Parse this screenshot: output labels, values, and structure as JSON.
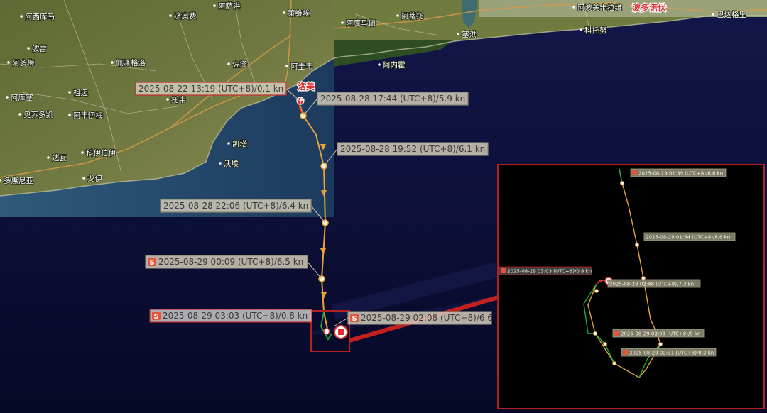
{
  "places": [
    {
      "id": "a-xi-ku-ma",
      "name": "阿西库马"
    },
    {
      "id": "ji-ao-fei",
      "name": "济奥费"
    },
    {
      "id": "a-sa-hong",
      "name": "阿萨洪"
    },
    {
      "id": "ce-wei-kui",
      "name": "策维埃"
    },
    {
      "id": "a-ku-ma-pei",
      "name": "阿库马佩"
    },
    {
      "id": "a-di-tuo",
      "name": "阿蒂托"
    },
    {
      "id": "a-bo-mei",
      "name": "阿波美卡拉维"
    },
    {
      "id": "bo-duo",
      "name": "波多诺伏"
    },
    {
      "id": "ba-da",
      "name": "巴达格里"
    },
    {
      "id": "sai-hong",
      "name": "塞洪"
    },
    {
      "id": "ke-li-wu",
      "name": "科托努"
    },
    {
      "id": "bo-lei",
      "name": "波雷"
    },
    {
      "id": "pei-la",
      "name": "佩泽格洛"
    },
    {
      "id": "a-duo-mei",
      "name": "阿多梅"
    },
    {
      "id": "zuo-ze",
      "name": "佐泽"
    },
    {
      "id": "a-gui-wei",
      "name": "阿圭韦"
    },
    {
      "id": "luo-mei",
      "name": "洛美"
    },
    {
      "id": "a-nei-huo",
      "name": "阿内霍"
    },
    {
      "id": "a-ku-sai",
      "name": "阿库塞"
    },
    {
      "id": "zu-mai",
      "name": "祖迈"
    },
    {
      "id": "tuo-wei",
      "name": "托韦"
    },
    {
      "id": "ao-su-duo-kai",
      "name": "奥苏多凯"
    },
    {
      "id": "a-wei-yi-mei",
      "name": "阿韦伊梅"
    },
    {
      "id": "da-wa",
      "name": "达瓦"
    },
    {
      "id": "ke-yi-bo-yi",
      "name": "科伊伯伊"
    },
    {
      "id": "kai-ta",
      "name": "凯塔"
    },
    {
      "id": "wo-ai",
      "name": "沃埃"
    },
    {
      "id": "ge-yi",
      "name": "戈伊"
    },
    {
      "id": "duo-hui-ni-ya",
      "name": "多惠尼亚"
    }
  ],
  "track_points": [
    {
      "id": "p1",
      "label": "2025-08-22 13:19 (UTC+8)/0.1 kn",
      "s_icon": false
    },
    {
      "id": "p2",
      "label": "2025-08-28 17:44 (UTC+8)/5.9 kn",
      "s_icon": false
    },
    {
      "id": "p3",
      "label": "2025-08-28 19:52 (UTC+8)/6.1 kn",
      "s_icon": false
    },
    {
      "id": "p4",
      "label": "2025-08-28 22:06 (UTC+8)/6.4 kn",
      "s_icon": false
    },
    {
      "id": "p5",
      "label": "2025-08-29 00:09 (UTC+8)/6.5 kn",
      "s_icon": true
    },
    {
      "id": "p6",
      "label": "2025-08-29 03:03 (UTC+8)/0.8 kn",
      "s_icon": true
    },
    {
      "id": "p7",
      "label": "2025-08-29 02:08 (UTC+8)/6.6",
      "s_icon": true
    }
  ],
  "inset_points": [
    {
      "id": "i1",
      "label": "2025-08-29 01:39 (UTC+8)/6.6 kn"
    },
    {
      "id": "i2",
      "label": "2025-08-29 01:54 (UTC+8)/6.6 kn"
    },
    {
      "id": "i3",
      "label": "2025-08-29 03:03 (UTC+8)/0.8 kn"
    },
    {
      "id": "i4",
      "label": "2025-08-29 02:48 (UTC+8)/7.3 kn"
    },
    {
      "id": "i5",
      "label": "2025-08-29 02:03 (UTC+8)/9 kn"
    },
    {
      "id": "i6",
      "label": "2025-08-29 02:31 (UTC+8)/8.2 kn"
    }
  ],
  "icons": {
    "start": "start-flag-icon",
    "end": "stop-marker-icon",
    "s": "s-badge-icon"
  },
  "colors": {
    "track": "#e8a23a",
    "inset_green": "#1fa93a",
    "frame_red": "#b42020",
    "label_red": "#e03030"
  }
}
